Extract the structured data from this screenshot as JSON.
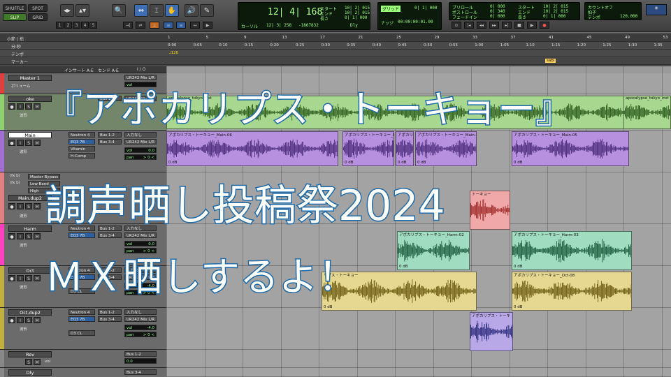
{
  "toolbar": {
    "mode_buttons": [
      "SHUFFLE",
      "SPOT",
      "SLIP",
      "GRID"
    ],
    "zoom_numbers": [
      "1",
      "2",
      "3",
      "4",
      "5"
    ],
    "counter": {
      "main": "12| 4| 168",
      "start_label": "スタート",
      "end_label": "エンド",
      "length_label": "長さ",
      "start": "10| 2| 015",
      "end": "10| 2| 015",
      "length": "0| 1| 000",
      "cursor_label": "カーソル",
      "cursor": "12| 3| 258",
      "sample": "-1867832",
      "dly": "Dly"
    },
    "transport_lcd": {
      "label": "ナッジ",
      "value": "00:00:00:01.00",
      "top": "0| 1| 000"
    },
    "right_lcd": {
      "preroll_label": "プリロール",
      "postroll_label": "ポストロール",
      "fade_label": "フェードイン",
      "preroll": "0| 000",
      "postroll": "0| 340",
      "fade": "0| 000",
      "start_label": "スタート",
      "end_label": "エンド",
      "length_label": "長さ",
      "start": "10| 2| 015",
      "end": "10| 2| 015",
      "length": "0| 1| 000"
    },
    "tempo_lcd": {
      "label1": "カウントオフ",
      "label2": "拍子",
      "label3": "テンポ",
      "value": "120.000"
    }
  },
  "rulers": {
    "bars_label": "小節 | 拍",
    "minsec_label": "分:秒",
    "tempo_label": "テンポ",
    "marker_label": "マーカー",
    "bar_ticks": [
      "1",
      "5",
      "9",
      "13",
      "17",
      "21",
      "25",
      "29",
      "33",
      "37",
      "41",
      "45",
      "49",
      "53"
    ],
    "time_ticks": [
      "0:00",
      "0:05",
      "0:10",
      "0:15",
      "0:20",
      "0:25",
      "0:30",
      "0:35",
      "0:40",
      "0:45",
      "0:50",
      "0:55",
      "1:00",
      "1:05",
      "1:10",
      "1:15",
      "1:20",
      "1:25",
      "1:30",
      "1:35"
    ],
    "tempo_value": "120",
    "marker_name": "sabi"
  },
  "columns": {
    "inserts": "インサート A-E",
    "sends": "センド A-E",
    "io": "I / O"
  },
  "tracks": [
    {
      "name": "Master 1",
      "sub": "ボリューム",
      "io": "UR242 Mix L/R",
      "vol": "vol",
      "color": "#e04040"
    },
    {
      "name": "oke",
      "sub": "波形",
      "io": "UR242 Mix L/R",
      "color": "#8fd070",
      "sends": "Bus 1-2"
    },
    {
      "name": "Main",
      "sub": "波形",
      "inserts": [
        "Neutron 4",
        "EQ3 7B",
        "Vitamin",
        "H-Comp"
      ],
      "sends": [
        "Bus 1-2",
        "Bus 3-4"
      ],
      "io": [
        "入力なし",
        "UR242 Mix L/R"
      ],
      "vol": "0.0",
      "pan": "> 0 <",
      "color": "#a070d0"
    },
    {
      "name": "Main.dup2",
      "sub": "波形",
      "fx": [
        "(fx b)",
        "Master Bypass",
        "(fx b)",
        "Low Band",
        "High"
      ],
      "color": "#e08080"
    },
    {
      "name": "Harm",
      "sub": "波形",
      "inserts": [
        "Neutron 4",
        "EQ3 7B"
      ],
      "sends": [
        "Bus 1-2",
        "Bus 3-4"
      ],
      "io": [
        "入力なし",
        "UR242 Mix L/R"
      ],
      "vol": "0.0",
      "pan": "> 0 <",
      "color": "#ff40c0"
    },
    {
      "name": "Oct",
      "sub": "波形",
      "inserts": [
        "Neutron 4",
        "EQ3 7B",
        "D3 CL"
      ],
      "sends": [
        "Bus 1-2",
        "Bus 3-4"
      ],
      "io": [
        "入力なし",
        "UR242 Mix L/R"
      ],
      "vol": "-4.0",
      "pan": "> 0 <",
      "color": "#c0b040"
    },
    {
      "name": "Oct.dup2",
      "sub": "波形",
      "inserts": [
        "Neutron 4",
        "EQ3 7B",
        "D3 CL"
      ],
      "sends": [
        "Bus 1-2",
        "Bus 3-4"
      ],
      "io": [
        "入力なし",
        "UR242 Mix L/R"
      ],
      "vol": "-4.0",
      "pan": "> 0 <",
      "color": "#c0b040"
    },
    {
      "name": "Rev",
      "sub": "vol",
      "io": "Bus 1-2",
      "vol": "0.0",
      "color": "#888888"
    },
    {
      "name": "Dly",
      "sub": "",
      "io": "Bus 3-4",
      "color": "#888888"
    }
  ],
  "clips": {
    "oke_left": "apocalypse_tokyo_inst",
    "oke_right": "apocalypse_tokyo_inst",
    "main_1": "アポカリプス・トーキョー_Main-06",
    "main_2": "アポカリプス・トーキョー_Main-",
    "main_3": "アポカリプス",
    "main_4": "アポカリプス・トーキョー_Main-0",
    "main_5": "アポカリプス・トーキョー_Main-05",
    "dup_clip": "トーキョー",
    "harm_1": "アポカリプス・トーキョー_Harm-02",
    "harm_2": "アポカリプス・トーキョー_Harm-03",
    "oct_1": "リプス・トーキョー",
    "oct_2": "アポカリプス・トーキョー_Oct-08",
    "octdup_1": "アポカリプス・トーキ",
    "db_label": "0 dB"
  },
  "overlay": {
    "line1": "『アポカリプス・トーキョー』",
    "line2": "調声晒し投稿祭2024",
    "line3": "ＭＸ晒しするよ！"
  },
  "colors": {
    "accent_blue": "#1f6aa8",
    "oke_clip": "#a8d890",
    "main_clip": "#b890e0",
    "harm_clip": "#a0dcc0",
    "oct_clip": "#e6d890",
    "dup_clip": "#f0a8a8",
    "octdup_clip": "#b8a8e8"
  }
}
